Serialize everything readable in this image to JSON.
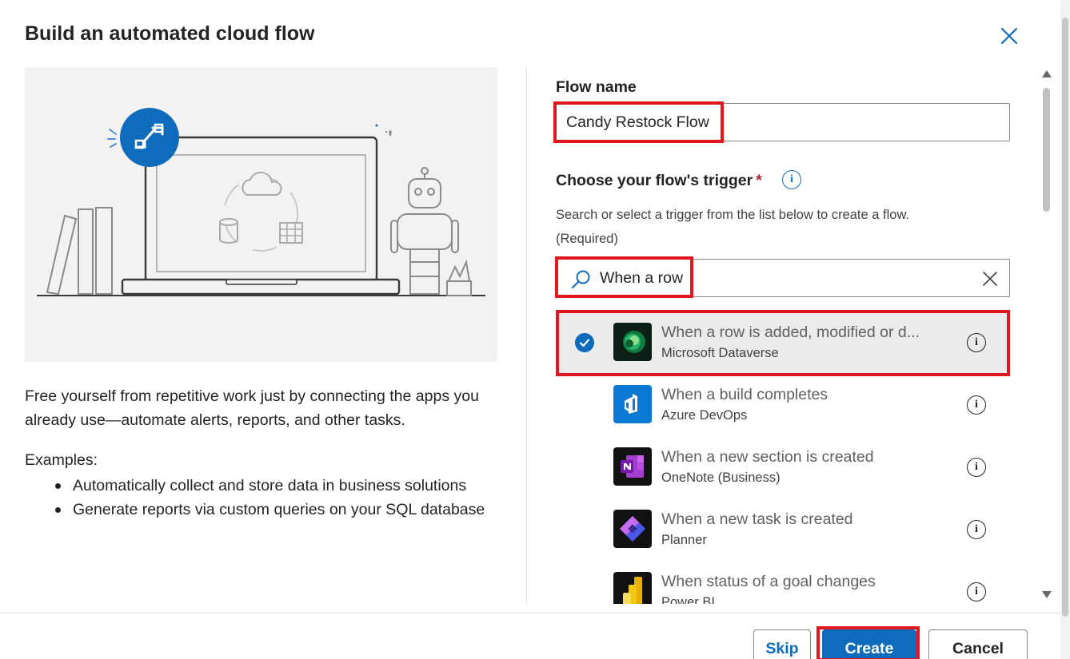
{
  "dialog": {
    "title": "Build an automated cloud flow"
  },
  "left": {
    "description": "Free yourself from repetitive work just by connecting the apps you already use—automate alerts, reports, and other tasks.",
    "examples_label": "Examples:",
    "examples": [
      "Automatically collect and store data in business solutions",
      "Generate reports via custom queries on your SQL database"
    ]
  },
  "form": {
    "flow_name_label": "Flow name",
    "flow_name_value": "Candy Restock Flow",
    "trigger_label": "Choose your flow's trigger",
    "required_mark": "*",
    "trigger_hint": "Search or select a trigger from the list below to create a flow.",
    "trigger_hint_required": "(Required)",
    "search_value": "When a row"
  },
  "triggers": [
    {
      "title": "When a row is added, modified or d...",
      "connector": "Microsoft Dataverse",
      "icon": "dataverse-icon",
      "selected": true
    },
    {
      "title": "When a build completes",
      "connector": "Azure DevOps",
      "icon": "azure-devops-icon",
      "selected": false
    },
    {
      "title": "When a new section is created",
      "connector": "OneNote (Business)",
      "icon": "onenote-icon",
      "selected": false
    },
    {
      "title": "When a new task is created",
      "connector": "Planner",
      "icon": "planner-icon",
      "selected": false
    },
    {
      "title": "When status of a goal changes",
      "connector": "Power BI",
      "icon": "power-bi-icon",
      "selected": false
    }
  ],
  "footer": {
    "skip_label": "Skip",
    "create_label": "Create",
    "cancel_label": "Cancel"
  },
  "colors": {
    "accent": "#0f6cbd",
    "highlight": "#e0171f",
    "selected_bg": "#ebebeb"
  }
}
